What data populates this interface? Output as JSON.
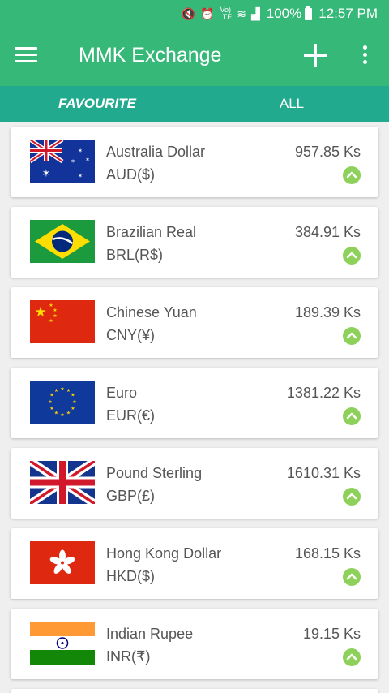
{
  "status_bar": {
    "battery": "100%",
    "time": "12:57 PM",
    "icons": [
      "mute-icon",
      "alarm-icon",
      "volte-icon",
      "wifi-icon",
      "signal-icon",
      "battery-icon"
    ]
  },
  "app_bar": {
    "title": "MMK Exchange",
    "background": "#36b878"
  },
  "tabs": [
    {
      "label": "FAVOURITE",
      "active": true
    },
    {
      "label": "ALL",
      "active": false
    }
  ],
  "tab_color": "#22aa8e",
  "currencies": [
    {
      "name": "Australia Dollar",
      "code": "AUD($)",
      "rate": "957.85 Ks",
      "flag": "australia-flag",
      "trend": "up"
    },
    {
      "name": "Brazilian Real",
      "code": "BRL(R$)",
      "rate": "384.91 Ks",
      "flag": "brazil-flag",
      "trend": "up"
    },
    {
      "name": "Chinese Yuan",
      "code": "CNY(¥)",
      "rate": "189.39 Ks",
      "flag": "china-flag",
      "trend": "up"
    },
    {
      "name": "Euro",
      "code": "EUR(€)",
      "rate": "1381.22 Ks",
      "flag": "eu-flag",
      "trend": "up"
    },
    {
      "name": "Pound Sterling",
      "code": "GBP(£)",
      "rate": "1610.31 Ks",
      "flag": "uk-flag",
      "trend": "up"
    },
    {
      "name": "Hong Kong Dollar",
      "code": "HKD($)",
      "rate": "168.15 Ks",
      "flag": "hong-kong-flag",
      "trend": "up"
    },
    {
      "name": "Indian Rupee",
      "code": "INR(₹)",
      "rate": "19.15 Ks",
      "flag": "india-flag",
      "trend": "up"
    }
  ]
}
